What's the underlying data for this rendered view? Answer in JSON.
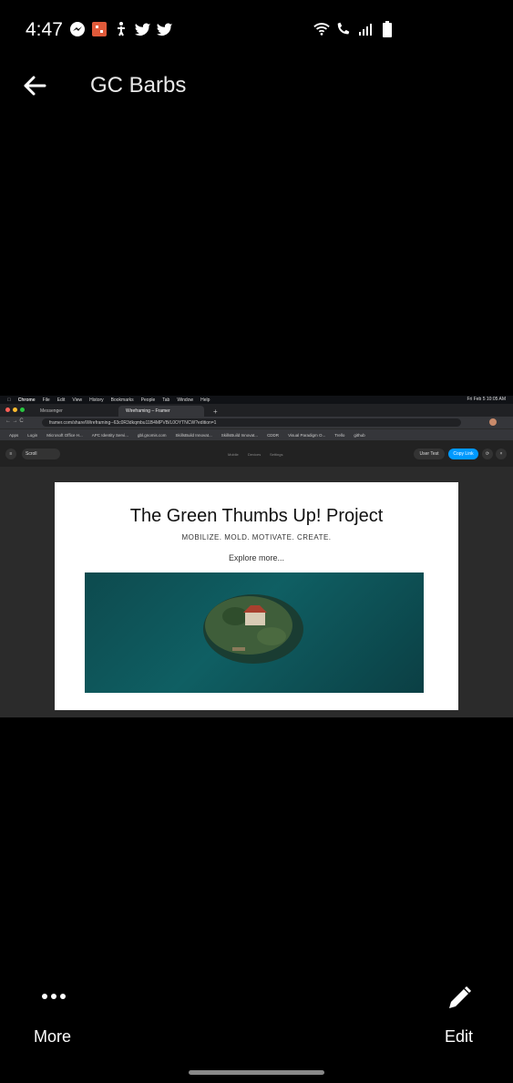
{
  "status_bar": {
    "time": "4:47"
  },
  "header": {
    "title": "GC Barbs"
  },
  "screenshot": {
    "mac_menu": [
      "Chrome",
      "File",
      "Edit",
      "View",
      "History",
      "Bookmarks",
      "People",
      "Tab",
      "Window",
      "Help"
    ],
    "mac_clock": "Fri Feb 5  10:05 AM",
    "tabs": [
      {
        "label": "Messenger"
      },
      {
        "label": "Wireframing – Framer"
      }
    ],
    "url": "framer.com/share/Wireframing--63c0R3dkqmbu11B4MPVB/L0OYTNCW?edition=1",
    "bookmarks": [
      "Apps",
      "Login",
      "Microsoft Office H...",
      "APC Identity Servi...",
      "gbl.gnomis.com",
      "SkillsBuild Innovat...",
      "SkillsBuild Innovat...",
      "CDDR",
      "Visual Paradigm O...",
      "Trello",
      "github"
    ],
    "framer": {
      "scroll_select": "Scroll",
      "tools": [
        "Mobile",
        "Devices",
        "Settings"
      ],
      "user_test": "User Test",
      "copy_link": "Copy Link"
    },
    "page": {
      "title": "The Green Thumbs Up! Project",
      "subtitle": "MOBILIZE. MOLD. MOTIVATE. CREATE.",
      "explore": "Explore more..."
    }
  },
  "bottom": {
    "more_label": "More",
    "edit_label": "Edit"
  }
}
